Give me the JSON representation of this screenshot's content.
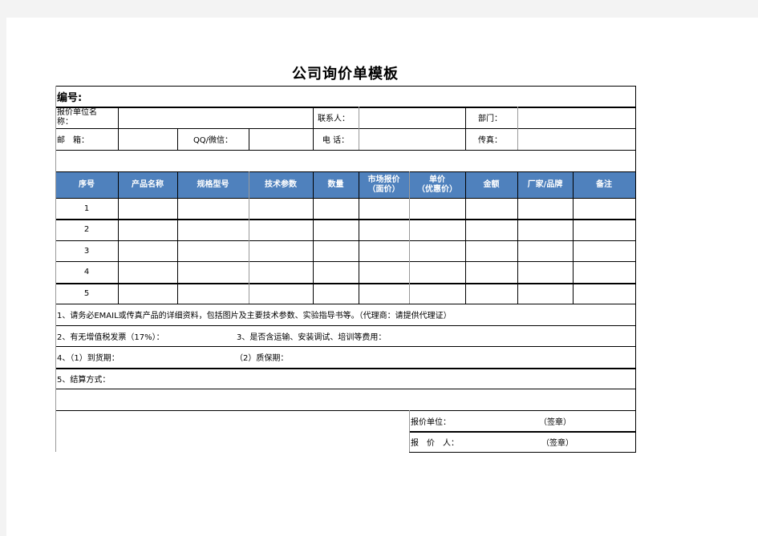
{
  "title": "公司询价单模板",
  "serial_label": "编号:",
  "info": {
    "company_label_line1": "报价单位名",
    "company_label_line2": "称：",
    "contact_label": "联系人：",
    "dept_label": "部门：",
    "email_label": "邮　箱：",
    "qq_label": "QQ/微信：",
    "phone_label": "电 话：",
    "fax_label": "传真："
  },
  "table": {
    "header_color": "#4f81bd",
    "columns": [
      "序号",
      "产品名称",
      "规格型号",
      "技术参数",
      "数量",
      "市场报价\n（面价）",
      "单价\n（优惠价）",
      "金额",
      "厂家/品牌",
      "备注"
    ],
    "rows": [
      "1",
      "2",
      "3",
      "4",
      "5"
    ]
  },
  "notes": {
    "n1": "1、请务必EMAIL或传真产品的详细资料，包括图片及主要技术参数、实验指导书等。（代理商：请提供代理证）",
    "n2": "2、有无增值税发票（17%）：",
    "n3": "3、是否含运输、安装调试、培训等费用：",
    "n4a": "4、（1）到货期：",
    "n4b": "（2）质保期：",
    "n5": "5、结算方式："
  },
  "signature": {
    "unit_label": "报价单位：",
    "unit_stamp": "（签章）",
    "person_label": "报　价　人：",
    "person_stamp": "（签章）"
  }
}
